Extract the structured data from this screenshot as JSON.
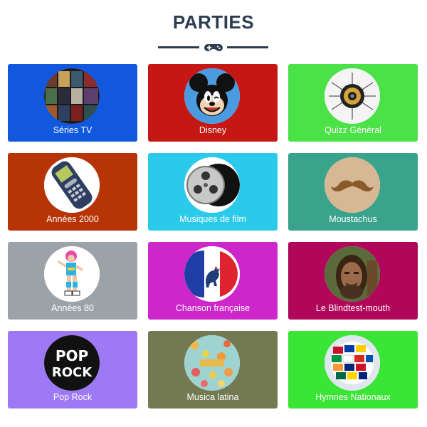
{
  "header": {
    "title": "PARTIES",
    "divider_icon": "gamepad-icon"
  },
  "cards": [
    {
      "label": "Séries TV",
      "color": "#1158df",
      "icon": "tv-series-thumbnail"
    },
    {
      "label": "Disney",
      "color": "#c51713",
      "icon": "mickey-thumbnail"
    },
    {
      "label": "Quizz Général",
      "color": "#4be248",
      "icon": "speaker-thumbnail"
    },
    {
      "label": "Années 2000",
      "color": "#b73406",
      "icon": "phone-thumbnail"
    },
    {
      "label": "Musiques de film",
      "color": "#2ccaea",
      "icon": "film-reel-thumbnail"
    },
    {
      "label": "Moustachus",
      "color": "#3aa38c",
      "icon": "mustache-thumbnail"
    },
    {
      "label": "Années 80",
      "color": "#9ba3a9",
      "icon": "dancer-thumbnail"
    },
    {
      "label": "Chanson française",
      "color": "#cd27cc",
      "icon": "french-flag-thumbnail"
    },
    {
      "label": "Le Blindtest-mouth",
      "color": "#b0075a",
      "icon": "caveman-thumbnail"
    },
    {
      "label": "Pop Rock",
      "color": "#9d79f6",
      "icon": "pop-rock-thumbnail",
      "thumb_text_1": "POP",
      "thumb_text_2": "ROCK"
    },
    {
      "label": "Musica latina",
      "color": "#737a51",
      "icon": "latina-thumbnail"
    },
    {
      "label": "Hymnes Nationaux",
      "color": "#3be536",
      "icon": "flags-globe-thumbnail"
    }
  ]
}
